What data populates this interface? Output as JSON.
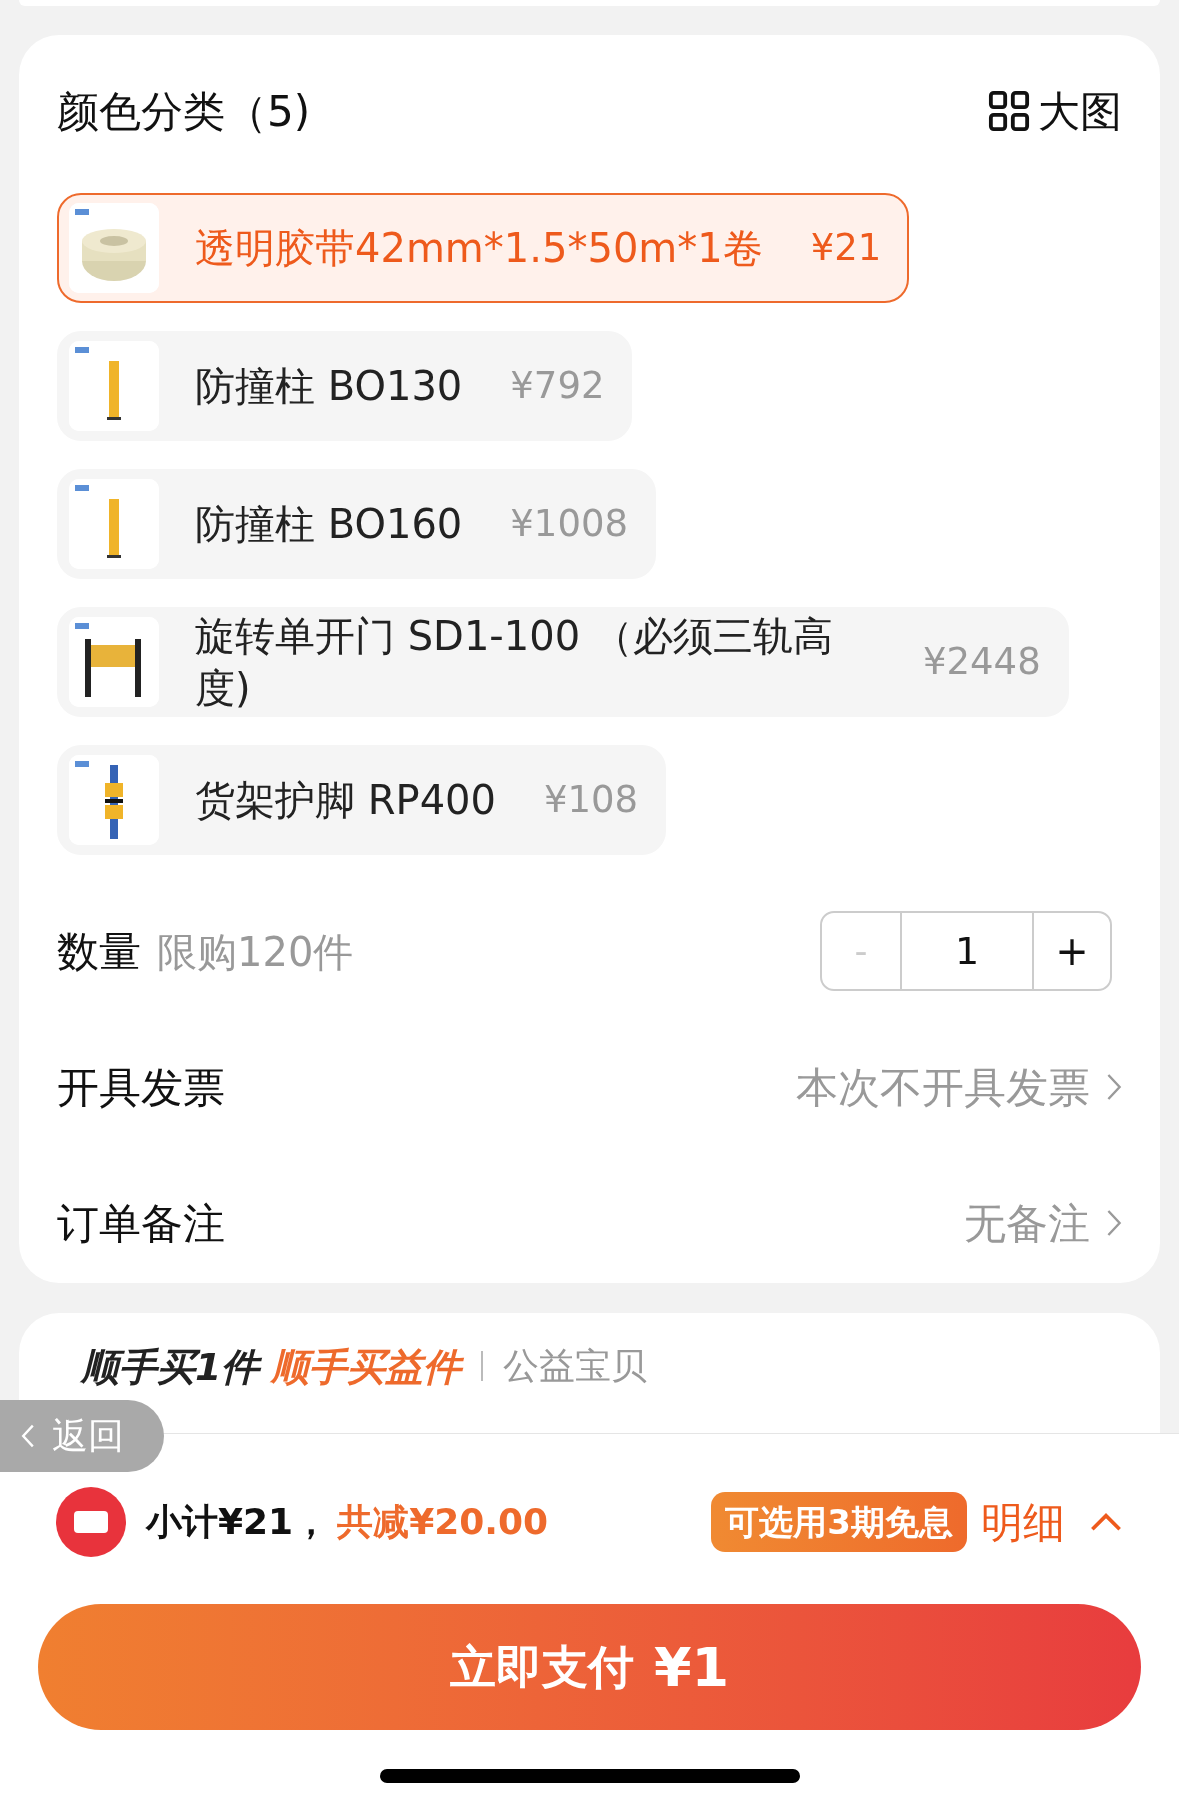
{
  "header": {
    "title": "颜色分类（5)",
    "view_toggle": "大图"
  },
  "options": [
    {
      "label": "透明胶带42mm*1.5*50m*1卷",
      "price": "¥21",
      "selected": true
    },
    {
      "label": "防撞柱 BO130",
      "price": "¥792",
      "selected": false
    },
    {
      "label": "防撞柱 BO160",
      "price": "¥1008",
      "selected": false
    },
    {
      "label": "旋转单开门 SD1-100 （必须三轨高度)",
      "price": "¥2448",
      "selected": false
    },
    {
      "label": "货架护脚 RP400",
      "price": "¥108",
      "selected": false
    }
  ],
  "quantity": {
    "label": "数量",
    "limit": "限购120件",
    "decrement": "-",
    "value": "1",
    "increment": "+",
    "decrement_disabled": true
  },
  "invoice": {
    "label": "开具发票",
    "value": "本次不开具发票"
  },
  "note": {
    "label": "订单备注",
    "value": "无备注"
  },
  "addon": {
    "title": "顺手买1件",
    "highlight": "顺手买益件",
    "tag": "公益宝贝"
  },
  "back_button": "返回",
  "summary": {
    "subtotal": "小计¥21，",
    "discount": "共减¥20.00",
    "installment_badge": "可选用3期免息",
    "details": "明细"
  },
  "pay_button": {
    "label": "立即支付",
    "amount": "¥1"
  }
}
